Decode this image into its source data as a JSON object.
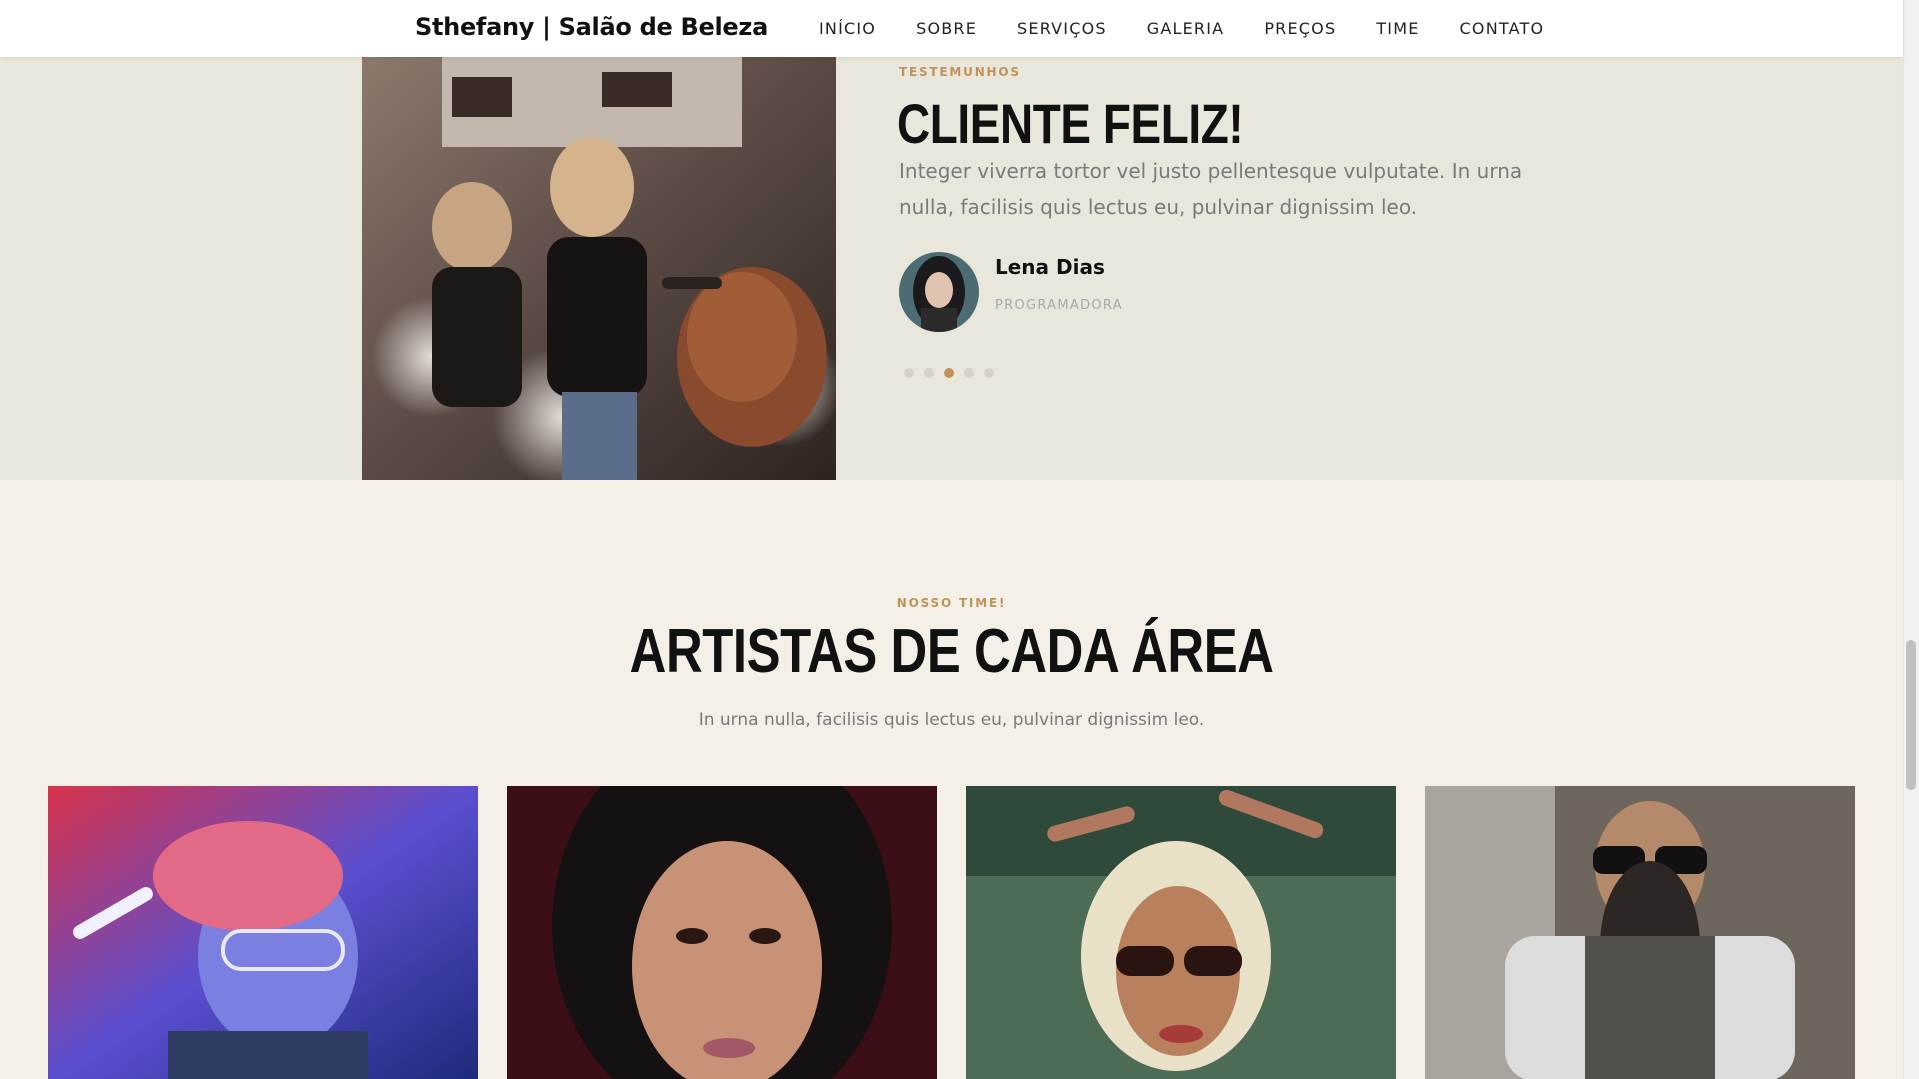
{
  "header": {
    "brand": "Sthefany | Salão de Beleza",
    "nav": [
      "INÍCIO",
      "SOBRE",
      "SERVIÇOS",
      "GALERIA",
      "PREÇOS",
      "TIME",
      "CONTATO"
    ]
  },
  "testimonial": {
    "eyebrow": "TESTEMUNHOS",
    "title": "CLIENTE FELIZ!",
    "quote": "Integer viverra tortor vel justo pellentesque vulputate. In urna nulla, facilisis quis lectus eu, pulvinar dignissim leo.",
    "author_name": "Lena Dias",
    "author_role": "PROGRAMADORA",
    "slide_count": 5,
    "active_slide": 3
  },
  "team": {
    "eyebrow": "NOSSO TIME!",
    "title": "ARTISTAS DE CADA ÁREA",
    "subtitle": "In urna nulla, facilisis quis lectus eu, pulvinar dignissim leo."
  },
  "colors": {
    "accent": "#c0935b",
    "testimonial_bg": "#e9e6dc",
    "page_bg": "#f4f0e8"
  }
}
